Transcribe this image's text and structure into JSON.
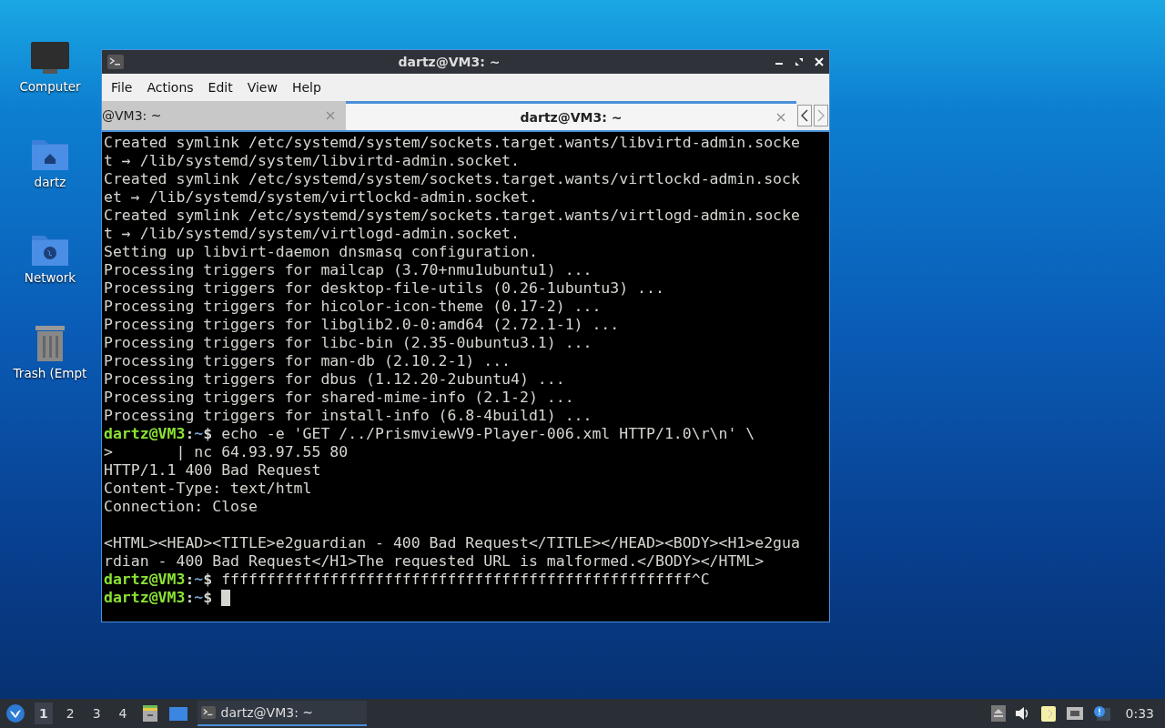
{
  "desktop_icons": [
    {
      "kind": "computer",
      "label": "Computer"
    },
    {
      "kind": "home",
      "label": "dartz"
    },
    {
      "kind": "network",
      "label": "Network"
    },
    {
      "kind": "trash",
      "label": "Trash (Empt"
    }
  ],
  "window": {
    "title": "dartz@VM3: ~",
    "menu": [
      "File",
      "Actions",
      "Edit",
      "View",
      "Help"
    ],
    "tabs": [
      {
        "label": "@VM3: ~",
        "selected": false
      },
      {
        "label": "dartz@VM3: ~",
        "selected": true
      }
    ],
    "terminal": {
      "lines": [
        {
          "kind": "output",
          "text": "Created symlink /etc/systemd/system/sockets.target.wants/libvirtd-admin.socke"
        },
        {
          "kind": "output",
          "text": "t → /lib/systemd/system/libvirtd-admin.socket."
        },
        {
          "kind": "output",
          "text": "Created symlink /etc/systemd/system/sockets.target.wants/virtlockd-admin.sock"
        },
        {
          "kind": "output",
          "text": "et → /lib/systemd/system/virtlockd-admin.socket."
        },
        {
          "kind": "output",
          "text": "Created symlink /etc/systemd/system/sockets.target.wants/virtlogd-admin.socke"
        },
        {
          "kind": "output",
          "text": "t → /lib/systemd/system/virtlogd-admin.socket."
        },
        {
          "kind": "output",
          "text": "Setting up libvirt-daemon dnsmasq configuration."
        },
        {
          "kind": "output",
          "text": "Processing triggers for mailcap (3.70+nmu1ubuntu1) ..."
        },
        {
          "kind": "output",
          "text": "Processing triggers for desktop-file-utils (0.26-1ubuntu3) ..."
        },
        {
          "kind": "output",
          "text": "Processing triggers for hicolor-icon-theme (0.17-2) ..."
        },
        {
          "kind": "output",
          "text": "Processing triggers for libglib2.0-0:amd64 (2.72.1-1) ..."
        },
        {
          "kind": "output",
          "text": "Processing triggers for libc-bin (2.35-0ubuntu3.1) ..."
        },
        {
          "kind": "output",
          "text": "Processing triggers for man-db (2.10.2-1) ..."
        },
        {
          "kind": "output",
          "text": "Processing triggers for dbus (1.12.20-2ubuntu4) ..."
        },
        {
          "kind": "output",
          "text": "Processing triggers for shared-mime-info (2.1-2) ..."
        },
        {
          "kind": "output",
          "text": "Processing triggers for install-info (6.8-4build1) ..."
        },
        {
          "kind": "prompt",
          "user": "dartz@VM3",
          "sep": ":",
          "path": "~",
          "mark": "$",
          "text": " echo -e 'GET /../PrismviewV9-Player-006.xml HTTP/1.0\\r\\n' \\"
        },
        {
          "kind": "output",
          "text": ">       | nc 64.93.97.55 80"
        },
        {
          "kind": "output",
          "text": "HTTP/1.1 400 Bad Request"
        },
        {
          "kind": "output",
          "text": "Content-Type: text/html"
        },
        {
          "kind": "output",
          "text": "Connection: Close"
        },
        {
          "kind": "blank"
        },
        {
          "kind": "output",
          "text": "<HTML><HEAD><TITLE>e2guardian - 400 Bad Request</TITLE></HEAD><BODY><H1>e2gua"
        },
        {
          "kind": "output",
          "text": "rdian - 400 Bad Request</H1>The requested URL is malformed.</BODY></HTML>"
        },
        {
          "kind": "prompt",
          "user": "dartz@VM3",
          "sep": ":",
          "path": "~",
          "mark": "$",
          "text": " ffffffffffffffffffffffffffffffffffffffffffffffffffff^C"
        },
        {
          "kind": "prompt",
          "user": "dartz@VM3",
          "sep": ":",
          "path": "~",
          "mark": "$",
          "cursor": true
        }
      ]
    }
  },
  "taskbar": {
    "workspaces": [
      {
        "label": "1",
        "selected": true
      },
      {
        "label": "2",
        "selected": false
      },
      {
        "label": "3",
        "selected": false
      },
      {
        "label": "4",
        "selected": false
      }
    ],
    "tasks": [
      {
        "label": "dartz@VM3: ~",
        "selected": true
      }
    ],
    "clock": "0:33"
  }
}
